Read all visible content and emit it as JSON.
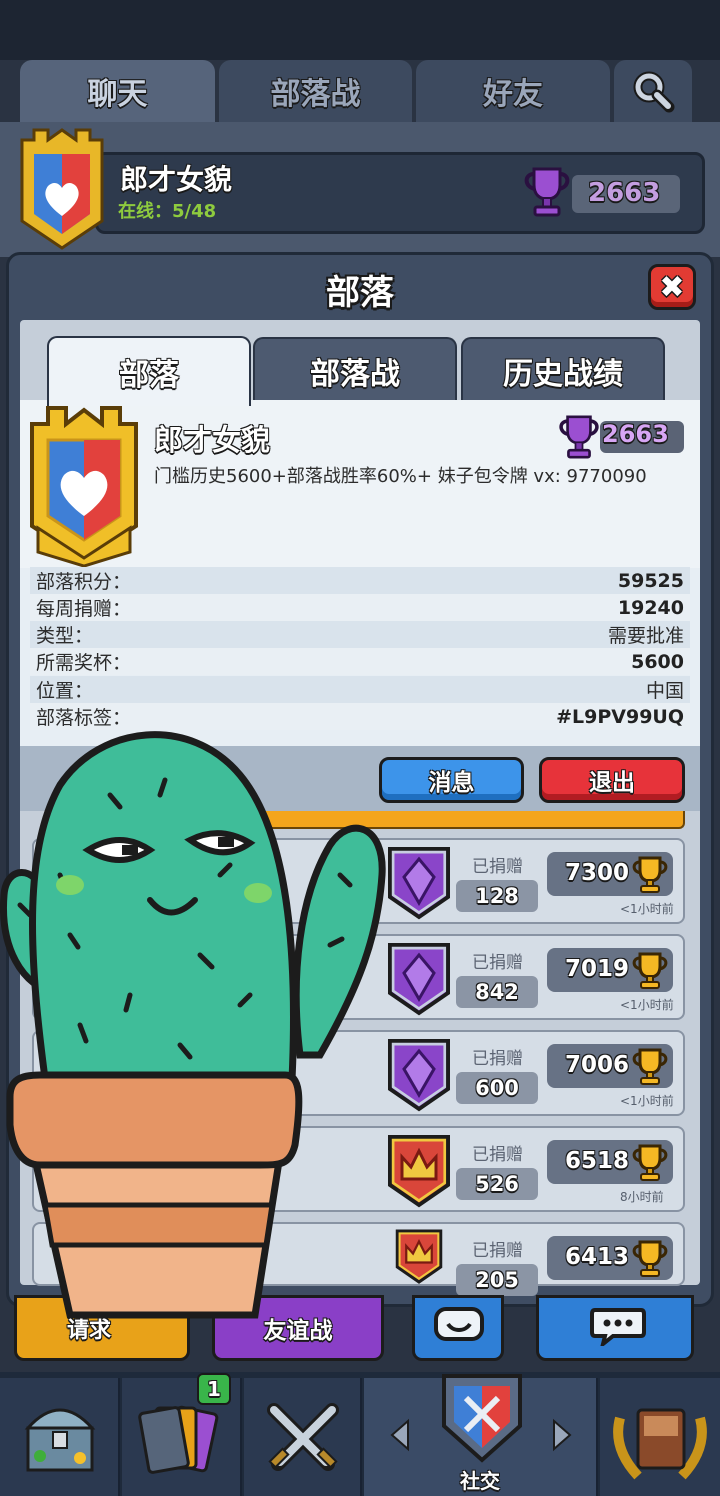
{
  "top_tabs": [
    {
      "label": "聊天",
      "active": true
    },
    {
      "label": "部落战",
      "active": false
    },
    {
      "label": "好友",
      "active": false
    }
  ],
  "clan_bar": {
    "name": "郎才女貌",
    "online": "在线：5/48",
    "trophies": "2663"
  },
  "modal": {
    "title": "部落",
    "close": "✖",
    "tabs": [
      {
        "label": "部落",
        "active": true
      },
      {
        "label": "部落战",
        "active": false
      },
      {
        "label": "历史战绩",
        "active": false
      }
    ]
  },
  "clan": {
    "name": "郎才女貌",
    "trophies": "2663",
    "description": "门槛历史5600+部落战胜率60%+ 妹子包令牌 vx: 9770090",
    "stats": [
      {
        "label": "部落积分：",
        "value": "59525",
        "bold": true
      },
      {
        "label": "每周捐赠：",
        "value": "19240",
        "bold": true
      },
      {
        "label": "类型：",
        "value": "需要批准",
        "bold": false
      },
      {
        "label": "所需奖杯：",
        "value": "5600",
        "bold": true
      },
      {
        "label": "位置：",
        "value": "中国",
        "bold": false
      },
      {
        "label": "部落标签：",
        "value": "#L9PV99UQ",
        "bold": true
      }
    ]
  },
  "actions": {
    "message": "消息",
    "leave": "退出"
  },
  "members": [
    {
      "donated_label": "已捐赠",
      "donated": "128",
      "trophies": "7300",
      "last_seen": "<1小时前",
      "arena": "purple"
    },
    {
      "donated_label": "已捐赠",
      "donated": "842",
      "trophies": "7019",
      "last_seen": "<1小时前",
      "arena": "purple"
    },
    {
      "donated_label": "已捐赠",
      "donated": "600",
      "trophies": "7006",
      "last_seen": "<1小时前",
      "arena": "purple"
    },
    {
      "donated_label": "已捐赠",
      "donated": "526",
      "trophies": "6518",
      "last_seen": "8小时前",
      "arena": "red"
    },
    {
      "donated_label": "已捐赠",
      "donated": "205",
      "trophies": "6413",
      "last_seen": "",
      "arena": "red"
    }
  ],
  "bottom_buttons": {
    "friendly_battle": "友谊战",
    "request": "请求"
  },
  "nav": {
    "social": "社交",
    "cards_badge": "1"
  },
  "colors": {
    "purple_trophy": "#9b4fd1",
    "gold_trophy": "#f5b824",
    "blue_button": "#3d94ea",
    "red_button": "#e7333a",
    "cactus_green": "#3fbd99"
  }
}
